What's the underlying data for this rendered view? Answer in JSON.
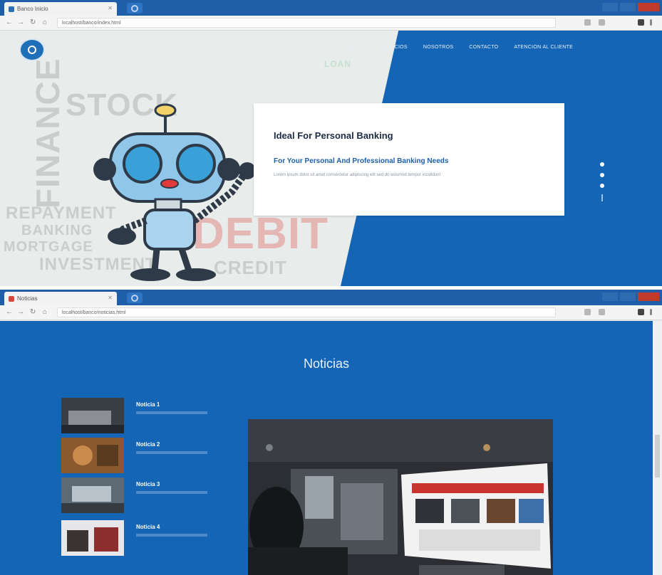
{
  "shot1": {
    "tab_title": "Banco Inicio",
    "url": "localhost/banco/index.html",
    "nav": [
      "INICIO",
      "SERVICIOS",
      "NOSOTROS",
      "CONTACTO",
      "ATENCION AL CLIENTE"
    ],
    "hero": {
      "title": "Ideal For Personal Banking",
      "subtitle": "For Your Personal And Professional Banking Needs",
      "body": "Lorem ipsum dolor sit amet consectetur adipiscing elit sed do eiusmod tempor incididunt"
    },
    "background_words": [
      "INVESTMENT",
      "REPAYMENT",
      "BANKING",
      "FINANCE",
      "CREDIT",
      "LOAN",
      "STOCK",
      "DEBIT",
      "MORTGAGE"
    ]
  },
  "shot2": {
    "tab_title": "Noticias",
    "url": "localhost/banco/noticias.html",
    "section_title": "Noticias",
    "news": [
      {
        "title": "Noticia 1"
      },
      {
        "title": "Noticia 2"
      },
      {
        "title": "Noticia 3"
      },
      {
        "title": "Noticia 4"
      }
    ]
  },
  "colors": {
    "brand_blue": "#1565b6",
    "browser_blue": "#1f5ea8",
    "card_title": "#1d2b44"
  },
  "icons": [
    "back-icon",
    "forward-icon",
    "reload-icon",
    "logo-icon",
    "robot-mascot",
    "slider-dot"
  ]
}
